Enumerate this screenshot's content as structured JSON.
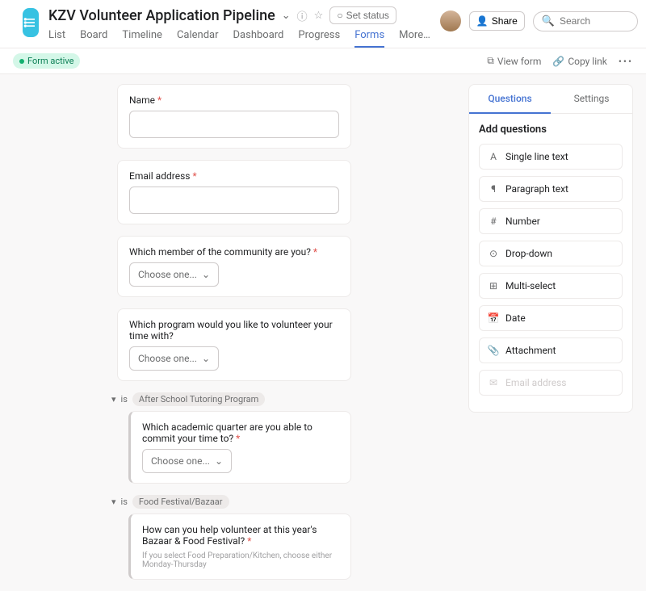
{
  "header": {
    "title": "KZV Volunteer Application Pipeline",
    "set_status": "Set status",
    "share": "Share",
    "search_placeholder": "Search"
  },
  "tabs": [
    "List",
    "Board",
    "Timeline",
    "Calendar",
    "Dashboard",
    "Progress",
    "Forms",
    "More…"
  ],
  "active_tab": "Forms",
  "subbar": {
    "form_active": "Form active",
    "view_form": "View form",
    "copy_link": "Copy link"
  },
  "form": {
    "fields": [
      {
        "label": "Name",
        "required": true,
        "type": "text"
      },
      {
        "label": "Email address",
        "required": true,
        "type": "text"
      },
      {
        "label": "Which member of the community are you?",
        "required": true,
        "type": "select",
        "placeholder": "Choose one..."
      },
      {
        "label": "Which program would you like to volunteer your time with?",
        "required": false,
        "type": "select",
        "placeholder": "Choose one..."
      }
    ],
    "branches": [
      {
        "condition_prefix": "is",
        "condition_value": "After School Tutoring Program",
        "field": {
          "label": "Which academic quarter are you able to commit your time to?",
          "required": true,
          "type": "select",
          "placeholder": "Choose one..."
        }
      },
      {
        "condition_prefix": "is",
        "condition_value": "Food Festival/Bazaar",
        "field": {
          "label": "How can you help volunteer at this year's Bazaar & Food Festival?",
          "required": true,
          "helper": "If you select Food Preparation/Kitchen, choose either Monday-Thursday"
        }
      }
    ]
  },
  "side": {
    "tabs": [
      "Questions",
      "Settings"
    ],
    "active": "Questions",
    "title": "Add questions",
    "types": [
      {
        "name": "Single line text",
        "icon": "A"
      },
      {
        "name": "Paragraph text",
        "icon": "¶"
      },
      {
        "name": "Number",
        "icon": "#"
      },
      {
        "name": "Drop-down",
        "icon": "⊙"
      },
      {
        "name": "Multi-select",
        "icon": "⊞"
      },
      {
        "name": "Date",
        "icon": "📅"
      },
      {
        "name": "Attachment",
        "icon": "📎"
      },
      {
        "name": "Email address",
        "icon": "✉",
        "disabled": true
      }
    ]
  }
}
